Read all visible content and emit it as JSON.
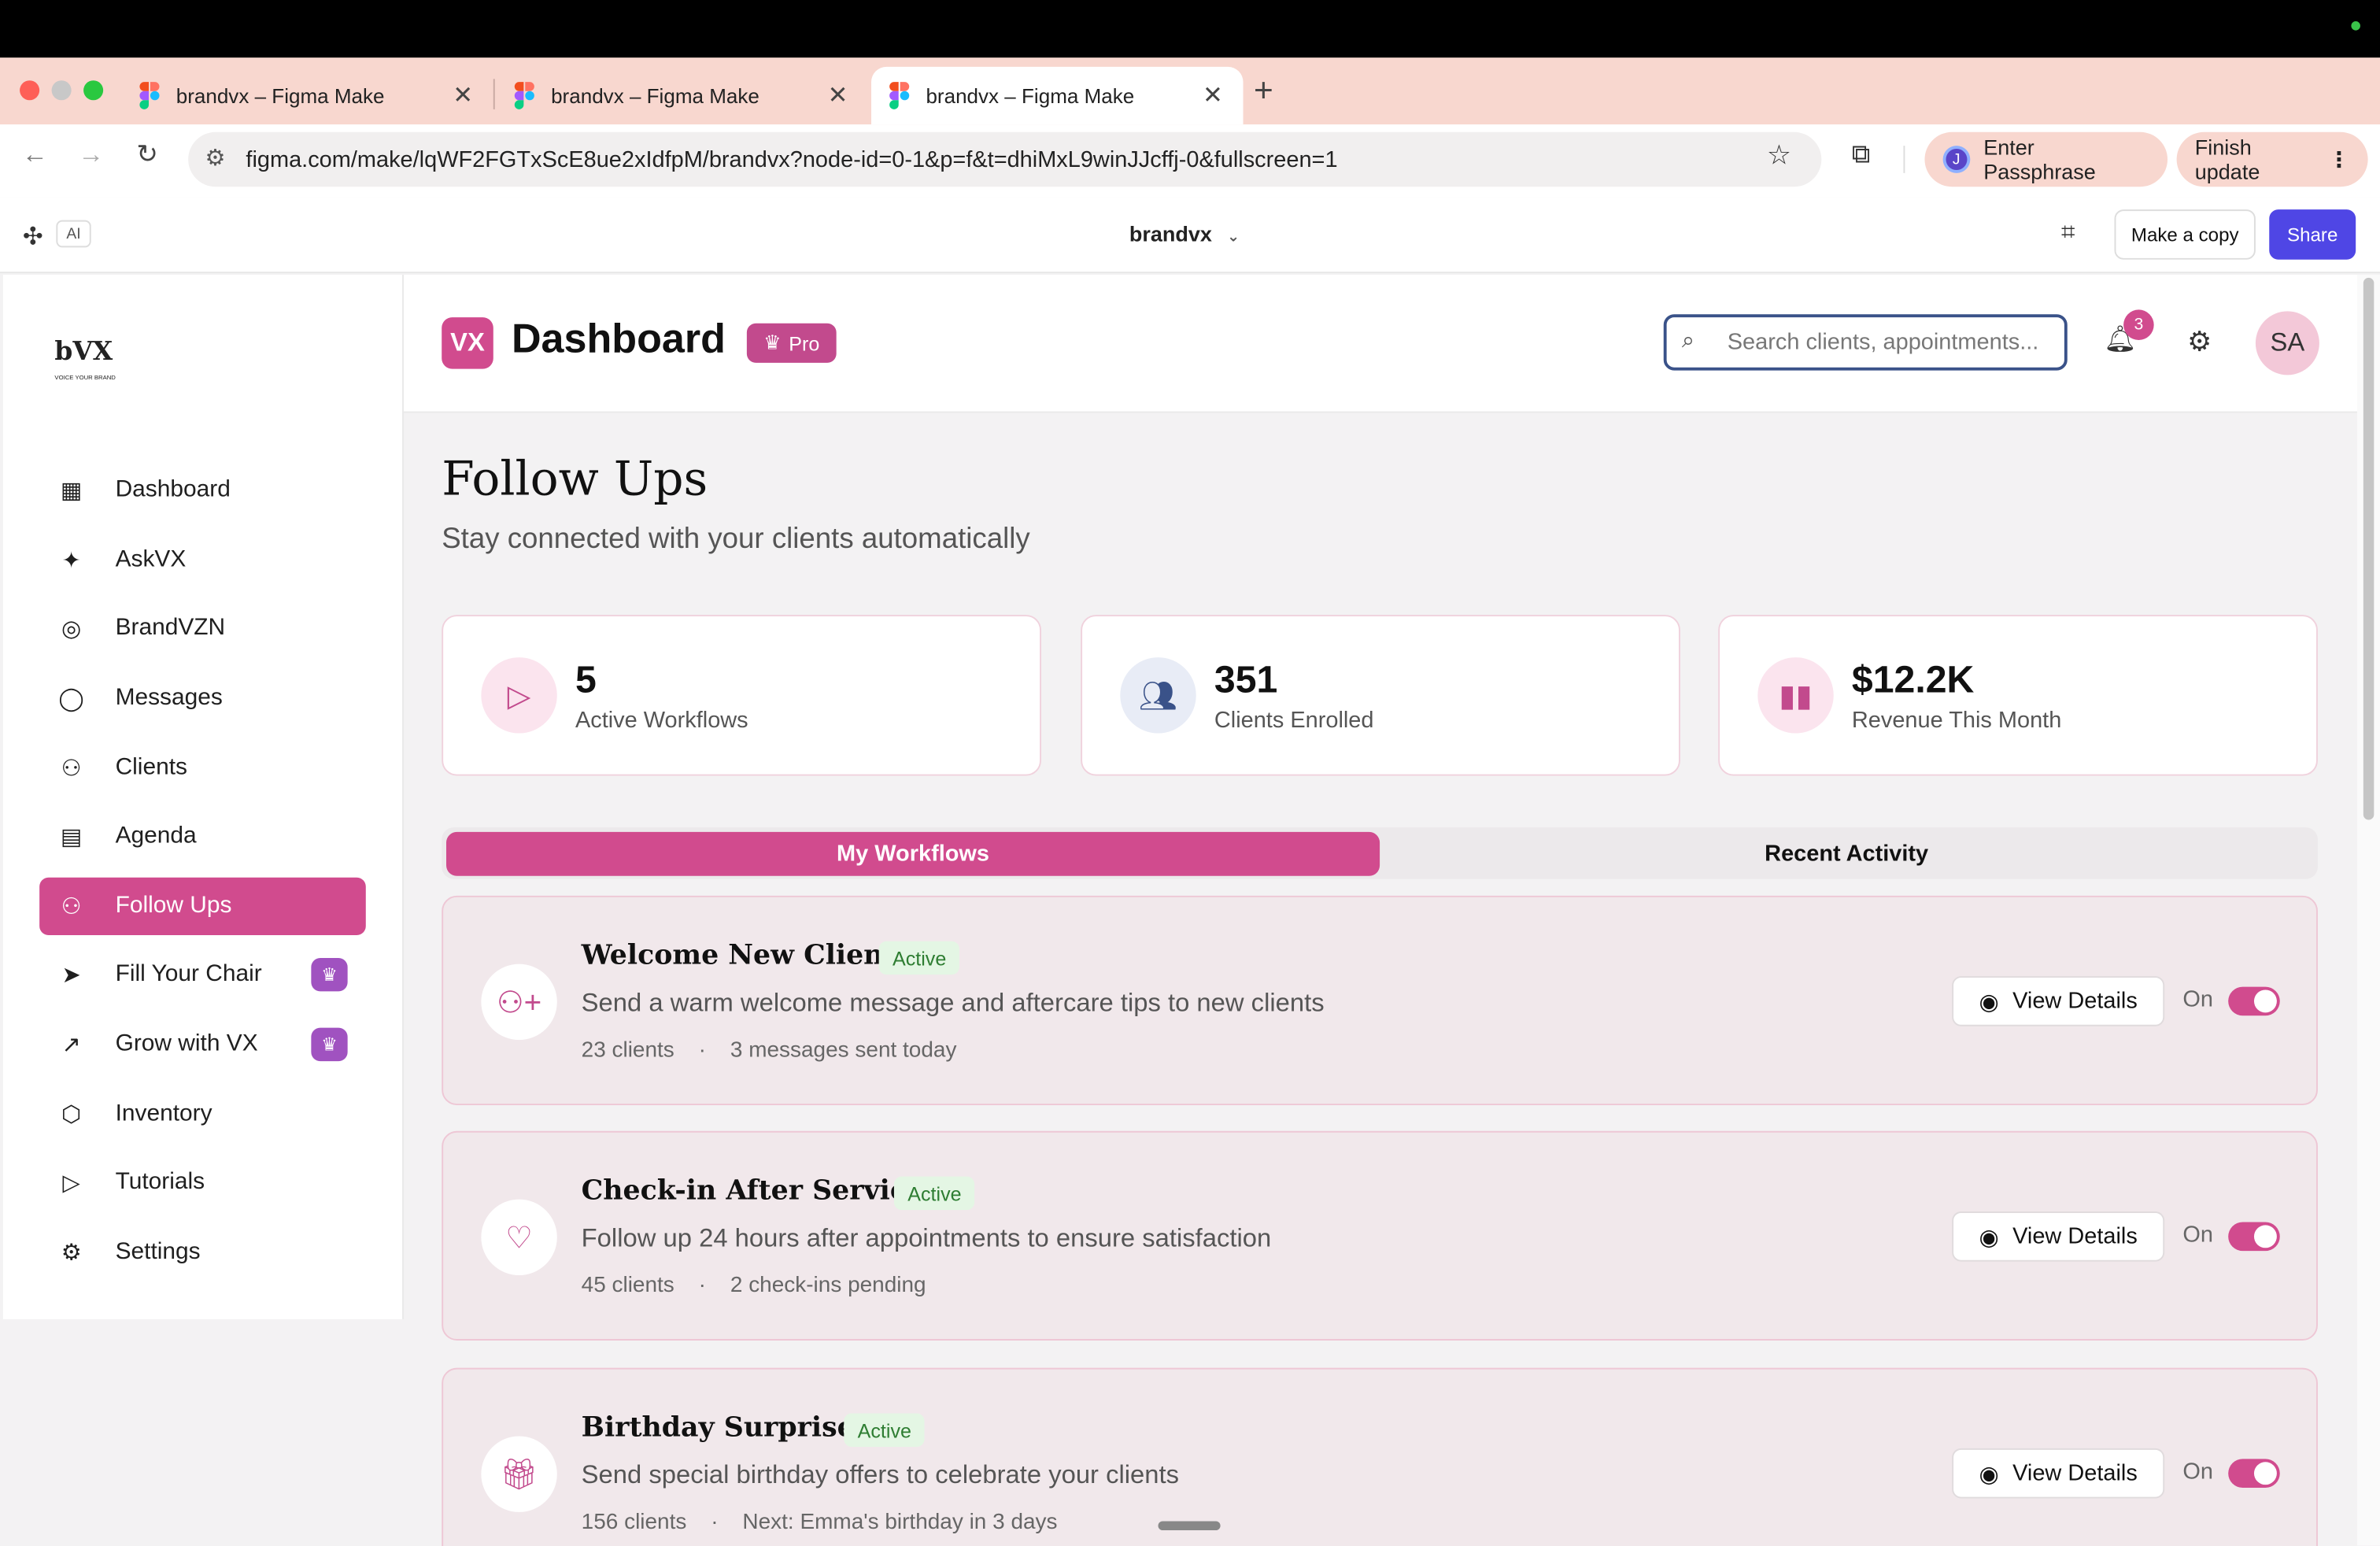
{
  "browser": {
    "tabs": [
      {
        "title": "brandvx – Figma Make"
      },
      {
        "title": "brandvx – Figma Make"
      },
      {
        "title": "brandvx – Figma Make"
      }
    ],
    "url": "figma.com/make/lqWF2FGTxScE8ue2xIdfpM/brandvx?node-id=0-1&p=f&t=dhiMxL9winJJcffj-0&fullscreen=1",
    "passphrase_button": "Enter Passphrase",
    "passphrase_avatar": "J",
    "finish_update_button": "Finish update"
  },
  "figma": {
    "ai_badge": "AI",
    "file_title": "brandvx",
    "make_copy_button": "Make a copy",
    "share_button": "Share"
  },
  "sidebar": {
    "logo_text": "bVX",
    "logo_sub": "VOICE YOUR BRAND",
    "items": [
      {
        "label": "Dashboard",
        "icon": "grid-icon"
      },
      {
        "label": "AskVX",
        "icon": "sparkles-icon"
      },
      {
        "label": "BrandVZN",
        "icon": "target-icon"
      },
      {
        "label": "Messages",
        "icon": "chat-icon"
      },
      {
        "label": "Clients",
        "icon": "users-icon"
      },
      {
        "label": "Agenda",
        "icon": "clipboard-icon"
      },
      {
        "label": "Follow Ups",
        "icon": "user-check-icon",
        "active": true
      },
      {
        "label": "Fill Your Chair",
        "icon": "cursor-icon",
        "premium": true
      },
      {
        "label": "Grow with VX",
        "icon": "trending-up-icon",
        "premium": true
      },
      {
        "label": "Inventory",
        "icon": "box-icon"
      },
      {
        "label": "Tutorials",
        "icon": "play-circle-icon"
      },
      {
        "label": "Settings",
        "icon": "gear-icon"
      }
    ]
  },
  "header": {
    "logo": "VX",
    "title": "Dashboard",
    "pro_badge": "Pro",
    "search_placeholder": "Search clients, appointments...",
    "notification_count": "3",
    "user_initials": "SA"
  },
  "main": {
    "title": "Follow Ups",
    "subtitle": "Stay connected with your clients automatically",
    "stats": [
      {
        "value": "5",
        "label": "Active Workflows",
        "icon": "play-icon"
      },
      {
        "value": "351",
        "label": "Clients Enrolled",
        "icon": "users-icon"
      },
      {
        "value": "$12.2K",
        "label": "Revenue This Month",
        "icon": "bar-chart-icon"
      }
    ],
    "tabs": [
      {
        "label": "My Workflows",
        "active": true
      },
      {
        "label": "Recent Activity",
        "active": false
      }
    ],
    "workflows": [
      {
        "title": "Welcome New Clients",
        "status": "Active",
        "description": "Send a warm welcome message and aftercare tips to new clients",
        "meta1": "23 clients",
        "meta2": "3 messages sent today",
        "view_label": "View Details",
        "toggle_label": "On",
        "enabled": true,
        "icon": "user-plus-icon"
      },
      {
        "title": "Check-in After Service",
        "status": "Active",
        "description": "Follow up 24 hours after appointments to ensure satisfaction",
        "meta1": "45 clients",
        "meta2": "2 check-ins pending",
        "view_label": "View Details",
        "toggle_label": "On",
        "enabled": true,
        "icon": "heart-icon"
      },
      {
        "title": "Birthday Surprises",
        "status": "Active",
        "description": "Send special birthday offers to celebrate your clients",
        "meta1": "156 clients",
        "meta2": "Next: Emma's birthday in 3 days",
        "view_label": "View Details",
        "toggle_label": "On",
        "enabled": true,
        "icon": "gift-icon"
      }
    ]
  },
  "colors": {
    "accent": "#d14b8e",
    "tabstrip": "#f8d7cf",
    "share": "#4f46e5"
  }
}
